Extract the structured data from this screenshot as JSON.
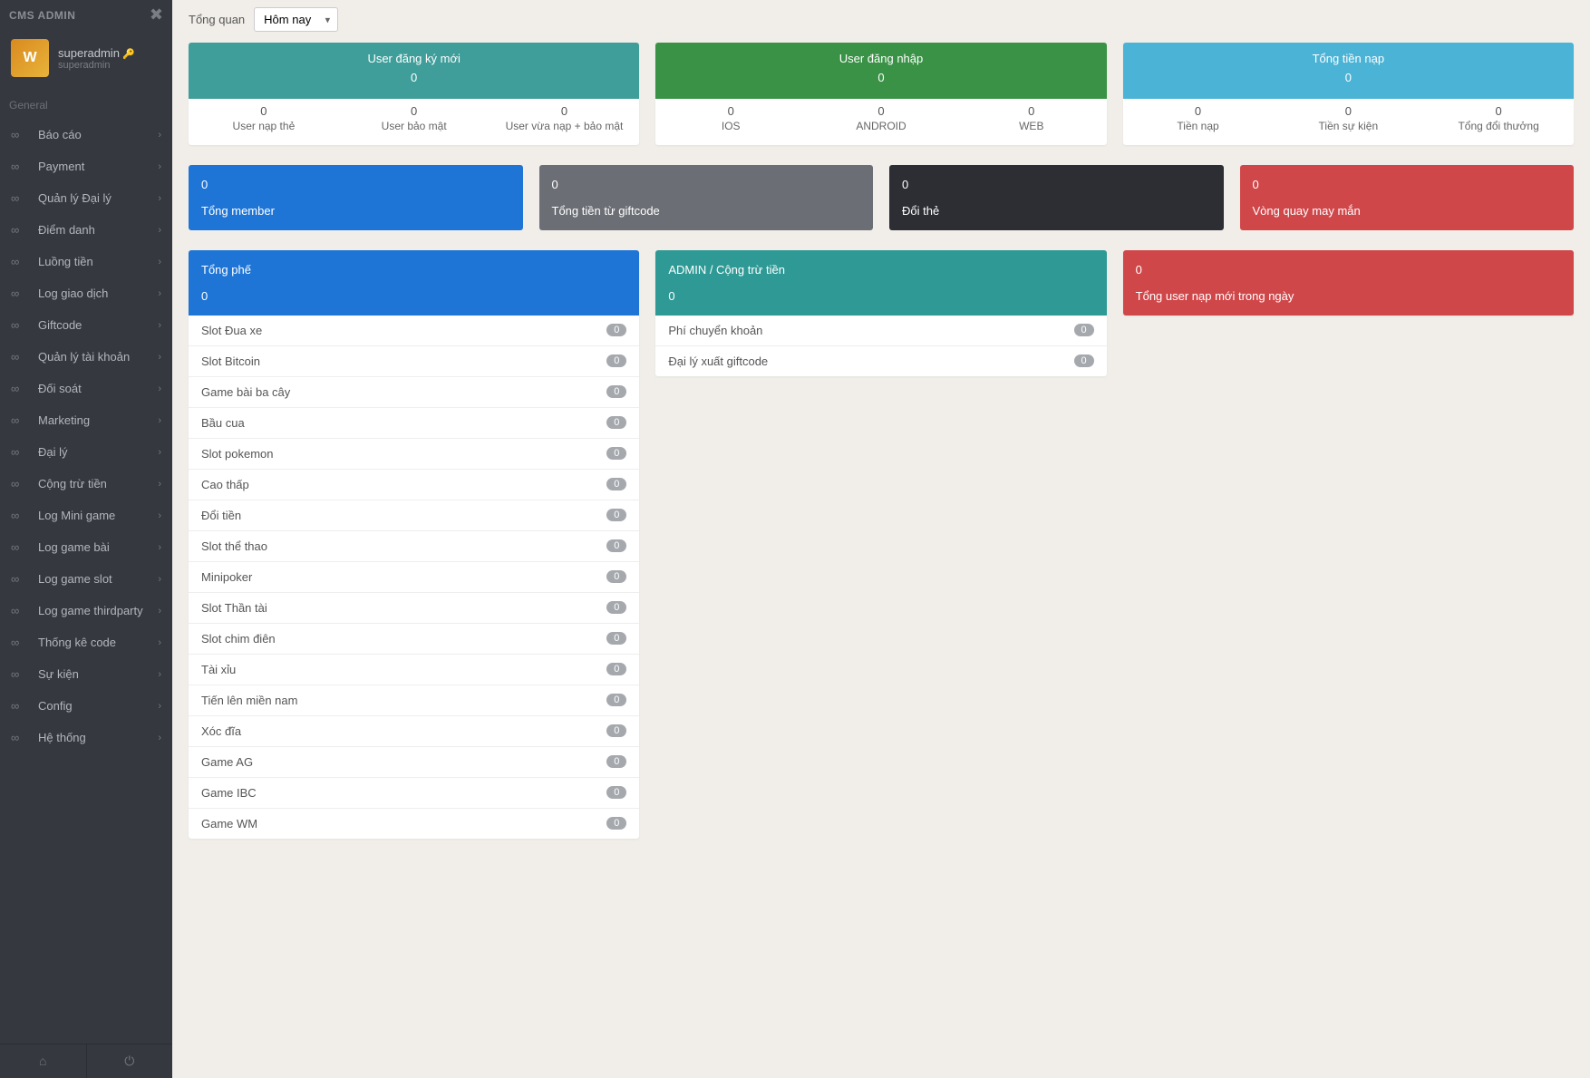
{
  "sidebar": {
    "title": "CMS ADMIN",
    "user": {
      "name": "superadmin",
      "role": "superadmin"
    },
    "section_label": "General",
    "items": [
      {
        "label": "Báo cáo"
      },
      {
        "label": "Payment"
      },
      {
        "label": "Quản lý Đại lý"
      },
      {
        "label": "Điểm danh"
      },
      {
        "label": "Luồng tiền"
      },
      {
        "label": "Log giao dịch"
      },
      {
        "label": "Giftcode"
      },
      {
        "label": "Quản lý tài khoản"
      },
      {
        "label": "Đối soát"
      },
      {
        "label": "Marketing"
      },
      {
        "label": "Đại lý"
      },
      {
        "label": "Cộng trừ tiền"
      },
      {
        "label": "Log Mini game"
      },
      {
        "label": "Log game bài"
      },
      {
        "label": "Log game slot"
      },
      {
        "label": "Log game thirdparty"
      },
      {
        "label": "Thống kê code"
      },
      {
        "label": "Sự kiện"
      },
      {
        "label": "Config"
      },
      {
        "label": "Hệ thống"
      }
    ]
  },
  "filter": {
    "label": "Tổng quan",
    "selected": "Hôm nay"
  },
  "top_cards": [
    {
      "color": "bg-teal",
      "title": "User đăng ký mới",
      "value": "0",
      "cells": [
        {
          "num": "0",
          "lbl": "User nạp thẻ"
        },
        {
          "num": "0",
          "lbl": "User bảo mật"
        },
        {
          "num": "0",
          "lbl": "User vừa nạp + bảo mật"
        }
      ]
    },
    {
      "color": "bg-green",
      "title": "User đăng nhập",
      "value": "0",
      "cells": [
        {
          "num": "0",
          "lbl": "IOS"
        },
        {
          "num": "0",
          "lbl": "ANDROID"
        },
        {
          "num": "0",
          "lbl": "WEB"
        }
      ]
    },
    {
      "color": "bg-sky",
      "title": "Tổng tiền nạp",
      "value": "0",
      "cells": [
        {
          "num": "0",
          "lbl": "Tiền nạp"
        },
        {
          "num": "0",
          "lbl": "Tiền sự kiện"
        },
        {
          "num": "0",
          "lbl": "Tổng đổi thưởng"
        }
      ]
    }
  ],
  "mid_cards": [
    {
      "color": "bg-blue",
      "num": "0",
      "lbl": "Tổng member"
    },
    {
      "color": "bg-gray",
      "num": "0",
      "lbl": "Tổng tiền từ giftcode"
    },
    {
      "color": "bg-dark",
      "num": "0",
      "lbl": "Đổi thẻ"
    },
    {
      "color": "bg-red",
      "num": "0",
      "lbl": "Vòng quay may mắn"
    }
  ],
  "panels": {
    "left": {
      "color": "bg-blue",
      "title": "Tổng phế",
      "value": "0",
      "items": [
        {
          "label": "Slot Đua xe",
          "badge": "0"
        },
        {
          "label": "Slot Bitcoin",
          "badge": "0"
        },
        {
          "label": "Game bài ba cây",
          "badge": "0"
        },
        {
          "label": "Bầu cua",
          "badge": "0"
        },
        {
          "label": "Slot pokemon",
          "badge": "0"
        },
        {
          "label": "Cao thấp",
          "badge": "0"
        },
        {
          "label": "Đổi tiền",
          "badge": "0"
        },
        {
          "label": "Slot thể thao",
          "badge": "0"
        },
        {
          "label": "Minipoker",
          "badge": "0"
        },
        {
          "label": "Slot Thần tài",
          "badge": "0"
        },
        {
          "label": "Slot chim điên",
          "badge": "0"
        },
        {
          "label": "Tài xỉu",
          "badge": "0"
        },
        {
          "label": "Tiến lên miền nam",
          "badge": "0"
        },
        {
          "label": "Xóc đĩa",
          "badge": "0"
        },
        {
          "label": "Game AG",
          "badge": "0"
        },
        {
          "label": "Game IBC",
          "badge": "0"
        },
        {
          "label": "Game WM",
          "badge": "0"
        }
      ]
    },
    "center": {
      "color": "bg-teal2",
      "title": "ADMIN / Cộng trừ tiền",
      "value": "0",
      "items": [
        {
          "label": "Phí chuyển khoản",
          "badge": "0"
        },
        {
          "label": "Đại lý xuất giftcode",
          "badge": "0"
        }
      ]
    },
    "right": {
      "color": "bg-red",
      "title": "Tổng user nạp mới trong ngày",
      "value": "0"
    }
  }
}
